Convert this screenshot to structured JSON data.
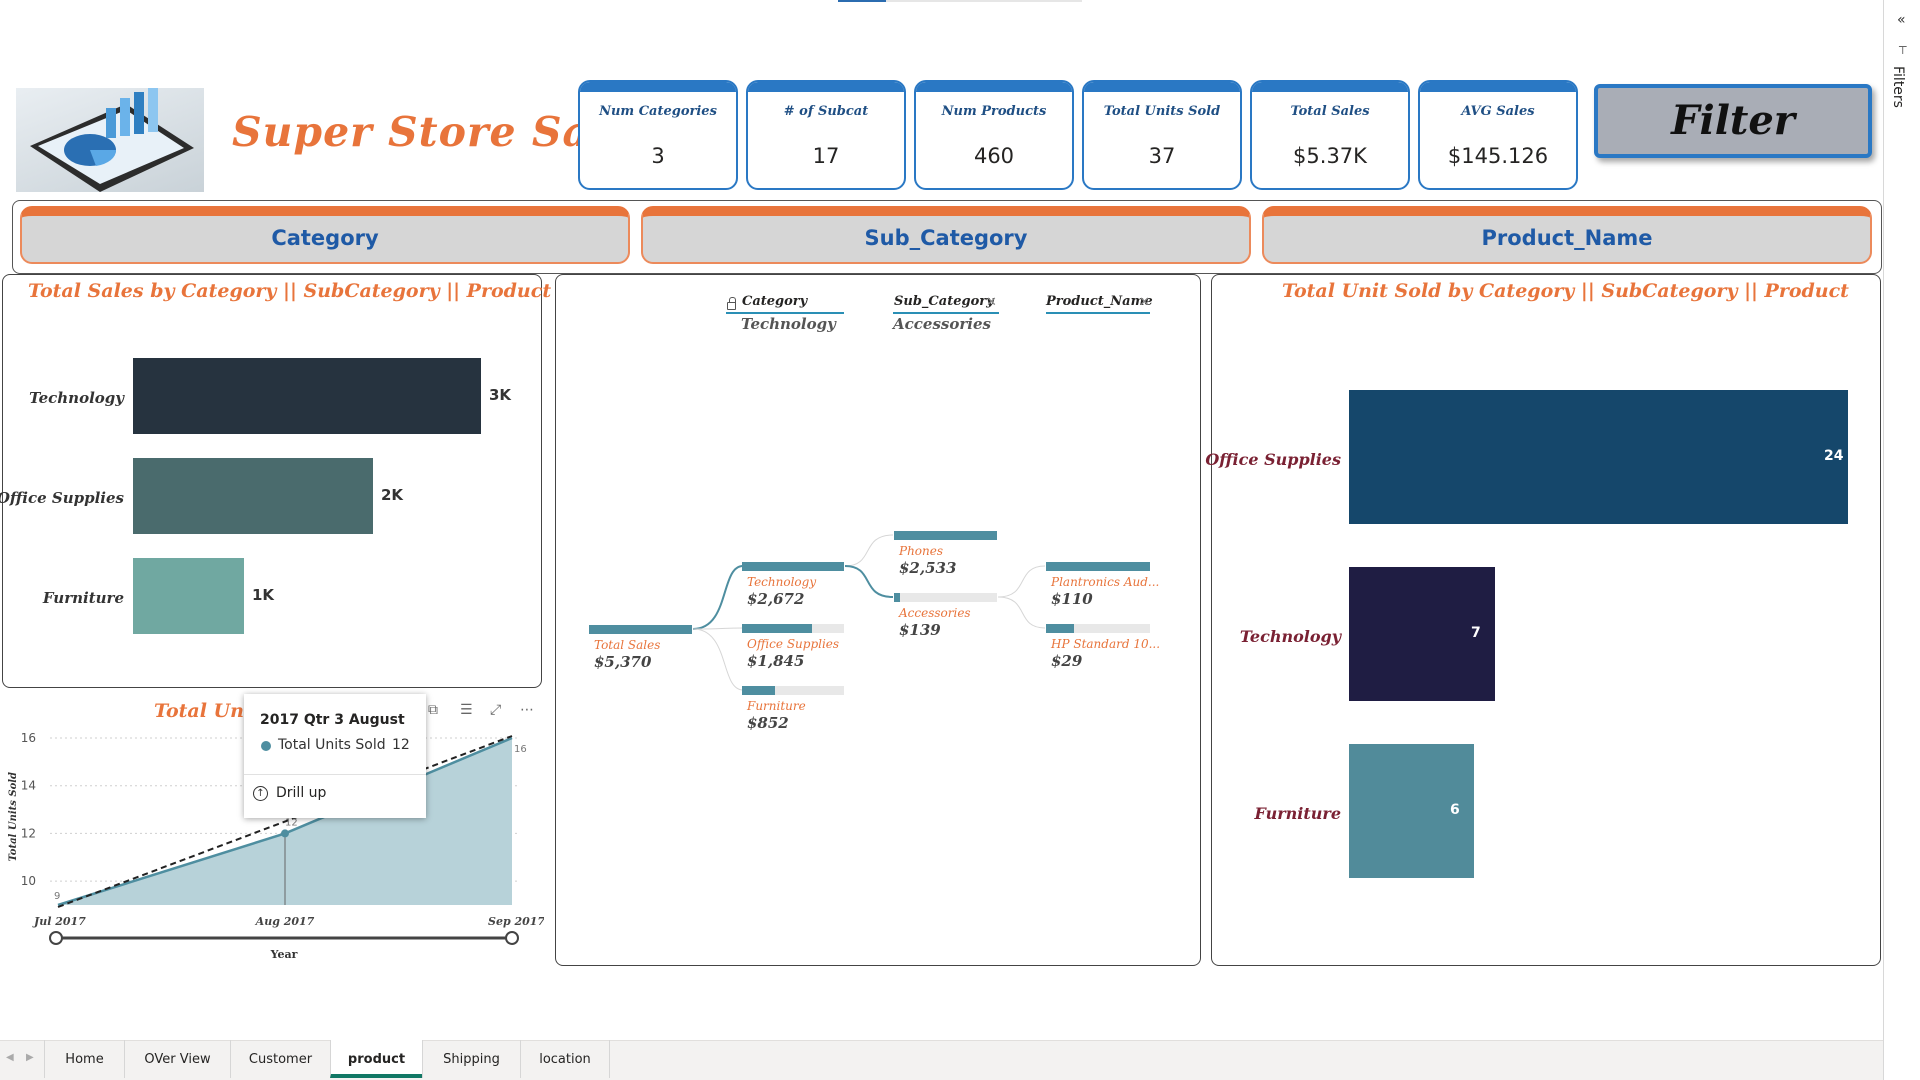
{
  "report": {
    "title": "Super Store Sales",
    "filter_button": "Filter"
  },
  "kpis": [
    {
      "label": "Num Categories",
      "value": "3"
    },
    {
      "label": "# of Subcat",
      "value": "17"
    },
    {
      "label": "Num Products",
      "value": "460"
    },
    {
      "label": "Total Units Sold",
      "value": "37"
    },
    {
      "label": "Total Sales",
      "value": "$5.37K"
    },
    {
      "label": "AVG Sales",
      "value": "$145.126"
    }
  ],
  "slicers": [
    "Category",
    "Sub_Category",
    "Product_Name"
  ],
  "colors": {
    "accent_orange": "#e8743b",
    "kpi_blue": "#2a78c4",
    "tech_bar": "#26333f",
    "office_bar": "#4a6b6d",
    "furniture_bar": "#70a8a1",
    "unit_office": "#15476b",
    "unit_tech": "#1f1d43",
    "unit_furniture": "#518b9a",
    "tree_bar": "#4e8ea0",
    "active_tab": "#117865"
  },
  "sales_chart": {
    "title": "Total Sales by Category || SubCategory || Product",
    "chart_data": {
      "type": "bar",
      "orientation": "horizontal",
      "categories": [
        "Technology",
        "Office Supplies",
        "Furniture"
      ],
      "values": [
        2672,
        1845,
        852
      ],
      "data_labels": [
        "3K",
        "2K",
        "1K"
      ]
    }
  },
  "units_chart": {
    "title": "Total Unit Sold by Category || SubCategory || Product",
    "chart_data": {
      "type": "bar",
      "orientation": "horizontal",
      "categories": [
        "Office Supplies",
        "Technology",
        "Furniture"
      ],
      "values": [
        24,
        7,
        6
      ]
    }
  },
  "line_chart": {
    "title_visible": "Total Unit",
    "chart_data": {
      "type": "area",
      "x": [
        "Jul 2017",
        "Aug 2017",
        "Sep 2017"
      ],
      "values": [
        9,
        12,
        16
      ],
      "point_labels": [
        "9",
        "12",
        "16"
      ],
      "ylim": [
        9,
        16
      ],
      "yticks": [
        10,
        12,
        14,
        16
      ],
      "xlabel": "Year",
      "ylabel": "Total Units Sold",
      "trend_line": true
    },
    "tooltip": {
      "title": "2017 Qtr 3 August",
      "series": "Total Units Sold",
      "value": "12",
      "action": "Drill up"
    },
    "visual_icons": [
      "copy-icon",
      "filter-icon",
      "focus-icon",
      "more-icon"
    ]
  },
  "decomp_tree": {
    "levels": [
      {
        "name": "Category",
        "selected": "Technology",
        "locked": true,
        "removable": false
      },
      {
        "name": "Sub_Category",
        "selected": "Accessories",
        "locked": false,
        "removable": true
      },
      {
        "name": "Product_Name",
        "selected": "",
        "locked": false,
        "removable": true
      }
    ],
    "root": {
      "name": "Total Sales",
      "value": "$5,370"
    },
    "categories": [
      {
        "name": "Technology",
        "value": "$2,672",
        "fraction": 1.0
      },
      {
        "name": "Office Supplies",
        "value": "$1,845",
        "fraction": 0.69
      },
      {
        "name": "Furniture",
        "value": "$852",
        "fraction": 0.32
      }
    ],
    "subcategories": [
      {
        "name": "Phones",
        "value": "$2,533",
        "fraction": 1.0
      },
      {
        "name": "Accessories",
        "value": "$139",
        "fraction": 0.06
      }
    ],
    "products": [
      {
        "name": "Plantronics Aud...",
        "value": "$110",
        "fraction": 1.0
      },
      {
        "name": "HP Standard 10...",
        "value": "$29",
        "fraction": 0.27
      }
    ]
  },
  "filters_pane": {
    "label": "Filters",
    "collapse": "«"
  },
  "tabs": [
    {
      "label": "Home",
      "active": false
    },
    {
      "label": "OVer View",
      "active": false
    },
    {
      "label": "Customer",
      "active": false
    },
    {
      "label": "product",
      "active": true
    },
    {
      "label": "Shipping",
      "active": false
    },
    {
      "label": "location",
      "active": false
    }
  ]
}
